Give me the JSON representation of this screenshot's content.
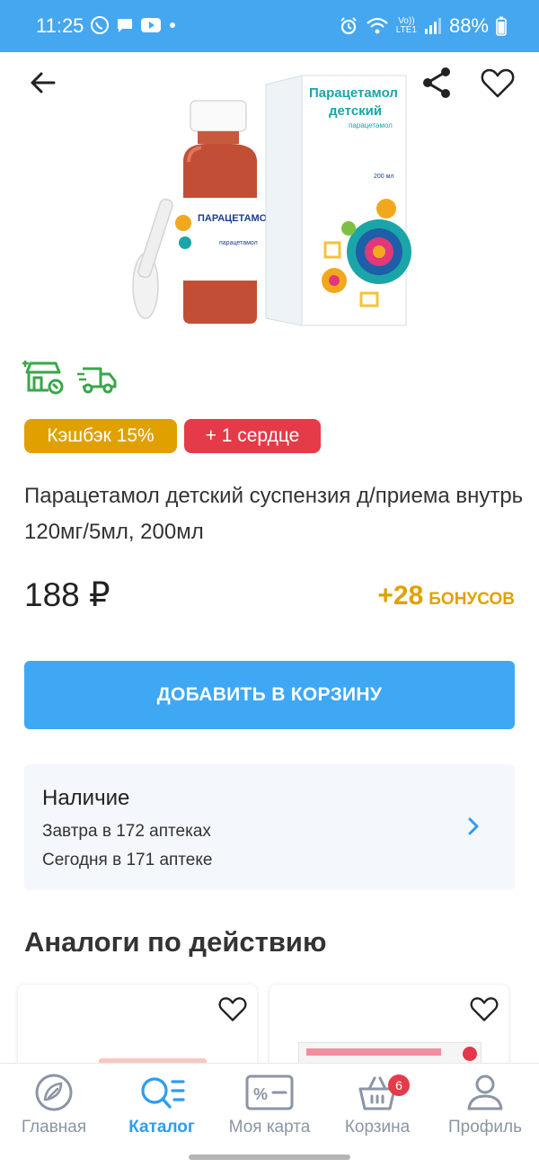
{
  "status_bar": {
    "time": "11:25",
    "battery": "88%",
    "network": "LTE1",
    "volte": "Vo))",
    "signal_number": "6"
  },
  "product": {
    "package_brand": "Парацетамол детский",
    "package_brand_bottle": "ПАРАЦЕТАМОЛ ДЕТСКИЙ",
    "package_subtitle": "парацетамол",
    "package_form": "суспензия для приема внутрь [для детей] 120 мг/5 мл",
    "package_volume": "200 мл",
    "title": "Парацетамол детский суспензия д/приема внутрь 120мг/5мл, 200мл",
    "price": "188 ₽",
    "bonus_amount": "+28",
    "bonus_label": "БОНУСОВ"
  },
  "badges": {
    "cashback": "Кэшбэк 15%",
    "heart": "+ 1 сердце"
  },
  "add_to_cart": {
    "label": "ДОБАВИТЬ В КОРЗИНУ"
  },
  "availability": {
    "title": "Наличие",
    "tomorrow": "Завтра в 172 аптеках",
    "today": "Сегодня в 171 аптеке"
  },
  "analogs": {
    "title": "Аналоги по действию"
  },
  "nav": {
    "items": [
      {
        "label": "Главная",
        "icon": "home-leaf-icon"
      },
      {
        "label": "Каталог",
        "icon": "catalog-search-icon",
        "active": true
      },
      {
        "label": "Моя карта",
        "icon": "loyalty-card-icon"
      },
      {
        "label": "Корзина",
        "icon": "basket-icon",
        "badge": "6"
      },
      {
        "label": "Профиль",
        "icon": "profile-icon"
      }
    ]
  },
  "colors": {
    "status_bar": "#44a7ef",
    "primary": "#3ea8f5",
    "cashback": "#e0a100",
    "heart": "#e53a48",
    "green_icons": "#3aa64a"
  }
}
